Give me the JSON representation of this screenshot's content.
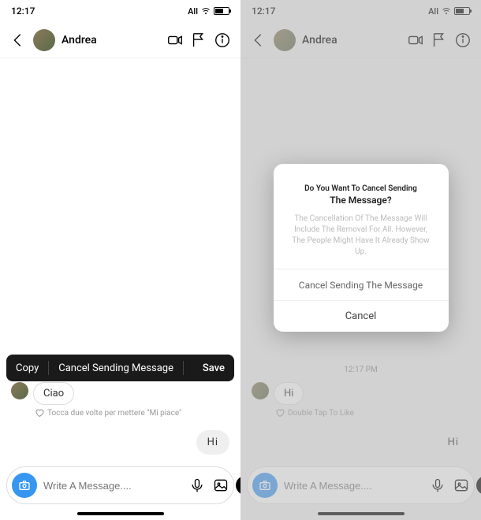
{
  "status": {
    "time": "12:17",
    "carrier": "All"
  },
  "header": {
    "username": "Andrea"
  },
  "chat": {
    "timestamp": "12:17 PM",
    "in_msg": "Ciao",
    "in_msg_right": "Hi",
    "like_hint": "Tocca due volte per mettere \"Mi piace\"",
    "like_hint_right": "Double Tap To Like",
    "out_msg": "Hi"
  },
  "context_menu": {
    "copy": "Copy",
    "cancel_send": "Cancel Sending Message",
    "save": "Save"
  },
  "composer": {
    "placeholder": "Write A Message...."
  },
  "dialog": {
    "title1": "Do You Want To Cancel Sending",
    "title2": "The Message?",
    "body": "The Cancellation Of The Message Will Include The Removal For All. However, The People Might Have It Already Show Up.",
    "confirm": "Cancel Sending The Message",
    "cancel": "Cancel"
  }
}
